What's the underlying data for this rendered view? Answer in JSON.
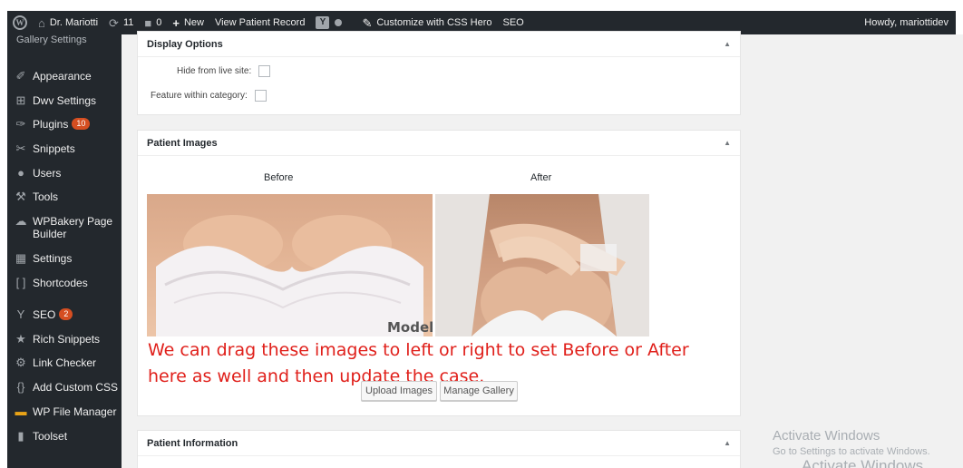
{
  "adminbar": {
    "site_name": "Dr. Mariotti",
    "updates_count": "11",
    "comments_count": "0",
    "new_label": "New",
    "view_record": "View Patient Record",
    "customize": "Customize with CSS Hero",
    "seo": "SEO",
    "howdy": "Howdy, mariottidev"
  },
  "sidebar": {
    "submenu_label": "Gallery Settings",
    "items": [
      {
        "label": "Appearance",
        "icon": "paintbrush-icon"
      },
      {
        "label": "Dwv Settings",
        "icon": "settings-icon"
      },
      {
        "label": "Plugins",
        "icon": "plug-icon",
        "badge": "10"
      },
      {
        "label": "Snippets",
        "icon": "scissors-icon"
      },
      {
        "label": "Users",
        "icon": "user-icon"
      },
      {
        "label": "Tools",
        "icon": "wrench-icon"
      },
      {
        "label": "WPBakery Page Builder",
        "icon": "cloud-icon"
      },
      {
        "label": "Settings",
        "icon": "settings-grid-icon"
      },
      {
        "label": "Shortcodes",
        "icon": "brackets-icon"
      },
      {
        "label": "SEO",
        "icon": "yoast-icon",
        "badge": "2"
      },
      {
        "label": "Rich Snippets",
        "icon": "star-icon"
      },
      {
        "label": "Link Checker",
        "icon": "gear-icon"
      },
      {
        "label": "Add Custom CSS",
        "icon": "braces-icon"
      },
      {
        "label": "WP File Manager",
        "icon": "folder-icon"
      },
      {
        "label": "Toolset",
        "icon": "toolset-icon"
      }
    ]
  },
  "display_options": {
    "title": "Display Options",
    "hide_label": "Hide from live site:",
    "feature_label": "Feature within category:"
  },
  "patient_images": {
    "title": "Patient Images",
    "before_label": "Before",
    "after_label": "After",
    "model_watermark": "Model",
    "annotation_line1": "We can drag these images to left or right to set Before or After",
    "annotation_line2": "here as well and then update the case.",
    "upload_button": "Upload Images",
    "manage_button": "Manage Gallery"
  },
  "patient_information": {
    "title": "Patient Information"
  },
  "watermark": {
    "line1": "Activate Windows",
    "line2": "Go to Settings to activate Windows.",
    "line3": "Activate Windows"
  },
  "colors": {
    "adminbar": "#23282d",
    "badge": "#d54e21",
    "annotation": "#e0201b"
  }
}
